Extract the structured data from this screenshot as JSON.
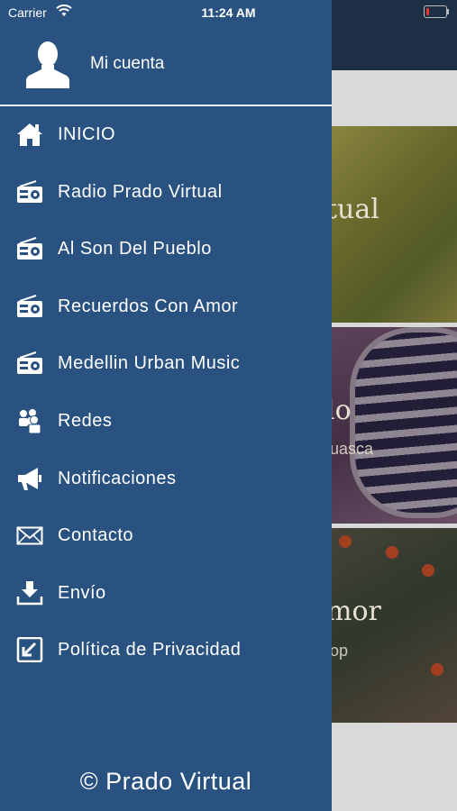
{
  "status_bar": {
    "carrier": "Carrier",
    "time": "11:24 AM"
  },
  "account": {
    "label": "Mi cuenta",
    "icon": "user-silhouette-icon"
  },
  "menu": [
    {
      "label": "INICIO",
      "icon": "home-icon"
    },
    {
      "label": "Radio Prado Virtual",
      "icon": "radio-icon"
    },
    {
      "label": "Al Son Del Pueblo",
      "icon": "radio-icon"
    },
    {
      "label": "Recuerdos Con Amor",
      "icon": "radio-icon"
    },
    {
      "label": "Medellin Urban Music",
      "icon": "radio-icon"
    },
    {
      "label": "Redes",
      "icon": "users-icon"
    },
    {
      "label": "Notificaciones",
      "icon": "megaphone-icon"
    },
    {
      "label": "Contacto",
      "icon": "envelope-icon"
    },
    {
      "label": "Envío",
      "icon": "download-icon"
    },
    {
      "label": "Política de Privacidad",
      "icon": "external-arrow-icon"
    }
  ],
  "footer": {
    "text": "© Prado Virtual"
  },
  "background_cards": [
    {
      "title": "tual",
      "subtitle": ""
    },
    {
      "title": "lo",
      "subtitle": "uasca"
    },
    {
      "title": "mor",
      "subtitle": "op"
    }
  ],
  "colors": {
    "drawer": "#2a5280",
    "header": "#1c2f45",
    "text": "#ffffff"
  }
}
